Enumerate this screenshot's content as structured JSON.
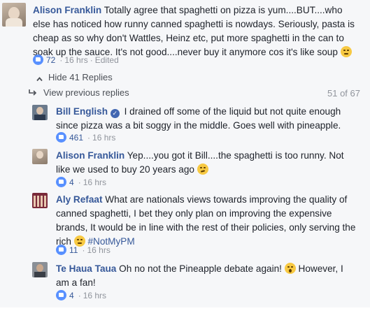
{
  "top_comment": {
    "author": "Alison Franklin",
    "text": "Totally agree that spaghetti on pizza is yum....BUT....who else has noticed how runny canned spaghetti is nowdays. Seriously, pasta is cheap as so why don't Wattles, Heinz etc, put more spaghetti in the can to soak up the sauce. It's not good....never buy it anymore cos it's like soup",
    "likes": "72",
    "time": "16 hrs",
    "edited": "Edited"
  },
  "replies_toggle": "Hide 41 Replies",
  "view_previous": {
    "label": "View previous replies",
    "counter": "51 of 67"
  },
  "replies": [
    {
      "author": "Bill English",
      "text": "I drained off some of the liquid but not quite enough since pizza was a bit soggy in the middle. Goes well with pineapple.",
      "likes": "461",
      "time": "16 hrs"
    },
    {
      "author": "Alison Franklin",
      "text": "Yep....you got it Bill....the spaghetti is too runny. Not like we used to buy 20 years ago",
      "likes": "4",
      "time": "16 hrs"
    },
    {
      "author": "Aly Refaat",
      "text": "What are nationals views towards improving the quality of canned spaghetti, I bet they only plan on improving the expensive brands, It would be in line with the rest of their policies, only serving the rich",
      "hashtag": "#NotMyPM",
      "likes": "11",
      "time": "16 hrs"
    },
    {
      "author": "Te Haua Taua",
      "text": "Oh no not the Pineapple debate again!",
      "text_after": "However, I am a fan!",
      "likes": "4",
      "time": "16 hrs"
    }
  ],
  "colors": {
    "link": "#365899",
    "meta": "#90949c",
    "like": "#5890ff",
    "background": "#f6f7f9"
  }
}
